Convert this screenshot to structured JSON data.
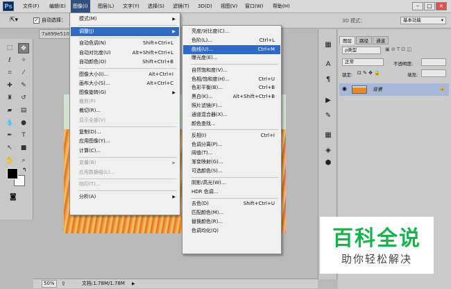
{
  "app": {
    "logo": "Ps"
  },
  "menubar": {
    "items": [
      "文件(F)",
      "编辑(E)",
      "图像(I)",
      "图层(L)",
      "文字(Y)",
      "选择(S)",
      "滤镜(T)",
      "3D(D)",
      "视图(V)",
      "窗口(W)",
      "帮助(H)"
    ],
    "active_index": 2,
    "window_buttons": [
      "–",
      "□",
      "×"
    ]
  },
  "options": {
    "auto_select_label": "自动选择：",
    "mode_label": "3D 模式：",
    "workspace": "基本功能"
  },
  "document": {
    "tab_label": "7a899e510",
    "zoom": "50%",
    "file_info": "文档:1.78M/1.78M"
  },
  "image_menu": [
    {
      "label": "模式(M)",
      "shortcut": "",
      "submenu": true,
      "disabled": false
    },
    {
      "sep": true
    },
    {
      "label": "调整(J)",
      "shortcut": "",
      "submenu": true,
      "disabled": false,
      "highlighted": true
    },
    {
      "sep": true
    },
    {
      "label": "自动色调(N)",
      "shortcut": "Shift+Ctrl+L",
      "disabled": false
    },
    {
      "label": "自动对比度(U)",
      "shortcut": "Alt+Shift+Ctrl+L",
      "disabled": false
    },
    {
      "label": "自动颜色(O)",
      "shortcut": "Shift+Ctrl+B",
      "disabled": false
    },
    {
      "sep": true
    },
    {
      "label": "图像大小(I)...",
      "shortcut": "Alt+Ctrl+I",
      "disabled": false
    },
    {
      "label": "画布大小(S)...",
      "shortcut": "Alt+Ctrl+C",
      "disabled": false
    },
    {
      "label": "图像旋转(G)",
      "shortcut": "",
      "submenu": true,
      "disabled": false
    },
    {
      "label": "裁剪(P)",
      "shortcut": "",
      "disabled": true
    },
    {
      "label": "裁切(R)...",
      "shortcut": "",
      "disabled": false
    },
    {
      "label": "显示全部(V)",
      "shortcut": "",
      "disabled": true
    },
    {
      "sep": true
    },
    {
      "label": "复制(D)...",
      "shortcut": "",
      "disabled": false
    },
    {
      "label": "应用图像(Y)...",
      "shortcut": "",
      "disabled": false
    },
    {
      "label": "计算(C)...",
      "shortcut": "",
      "disabled": false
    },
    {
      "sep": true
    },
    {
      "label": "变量(B)",
      "shortcut": "",
      "submenu": true,
      "disabled": true
    },
    {
      "label": "应用数据组(L)...",
      "shortcut": "",
      "disabled": true
    },
    {
      "sep": true
    },
    {
      "label": "陷印(T)...",
      "shortcut": "",
      "disabled": true
    },
    {
      "sep": true
    },
    {
      "label": "分析(A)",
      "shortcut": "",
      "submenu": true,
      "disabled": false
    }
  ],
  "adjust_menu": [
    {
      "label": "亮度/对比度(C)...",
      "shortcut": ""
    },
    {
      "label": "色阶(L)...",
      "shortcut": "Ctrl+L"
    },
    {
      "label": "曲线(U)...",
      "shortcut": "Ctrl+M",
      "highlighted": true
    },
    {
      "label": "曝光度(E)...",
      "shortcut": ""
    },
    {
      "sep": true
    },
    {
      "label": "自然饱和度(V)...",
      "shortcut": ""
    },
    {
      "label": "色相/饱和度(H)...",
      "shortcut": "Ctrl+U"
    },
    {
      "label": "色彩平衡(B)...",
      "shortcut": "Ctrl+B"
    },
    {
      "label": "黑白(K)...",
      "shortcut": "Alt+Shift+Ctrl+B"
    },
    {
      "label": "照片滤镜(F)...",
      "shortcut": ""
    },
    {
      "label": "通道混合器(X)...",
      "shortcut": ""
    },
    {
      "label": "颜色查找...",
      "shortcut": ""
    },
    {
      "sep": true
    },
    {
      "label": "反相(I)",
      "shortcut": "Ctrl+I"
    },
    {
      "label": "色调分离(P)...",
      "shortcut": ""
    },
    {
      "label": "阈值(T)...",
      "shortcut": ""
    },
    {
      "label": "渐变映射(G)...",
      "shortcut": ""
    },
    {
      "label": "可选颜色(S)...",
      "shortcut": ""
    },
    {
      "sep": true
    },
    {
      "label": "阴影/高光(W)...",
      "shortcut": ""
    },
    {
      "label": "HDR 色调...",
      "shortcut": ""
    },
    {
      "sep": true
    },
    {
      "label": "去色(D)",
      "shortcut": "Shift+Ctrl+U"
    },
    {
      "label": "匹配颜色(M)...",
      "shortcut": ""
    },
    {
      "label": "替换颜色(R)...",
      "shortcut": ""
    },
    {
      "label": "色调均化(Q)",
      "shortcut": ""
    }
  ],
  "layers_panel": {
    "tabs": [
      "图层",
      "路径",
      "通道"
    ],
    "kind_filter": "ρ类型",
    "blend_mode": "正常",
    "opacity_label": "不透明度:",
    "lock_label": "锁定:",
    "fill_label": "填充:",
    "layer_name": "背景"
  },
  "watermark": {
    "title": "百科全说",
    "subtitle": "助你轻松解决"
  },
  "colors": {
    "menu_highlight": "#316ac5",
    "active_menubar": "#34507e",
    "watermark_green": "#19b34d"
  }
}
